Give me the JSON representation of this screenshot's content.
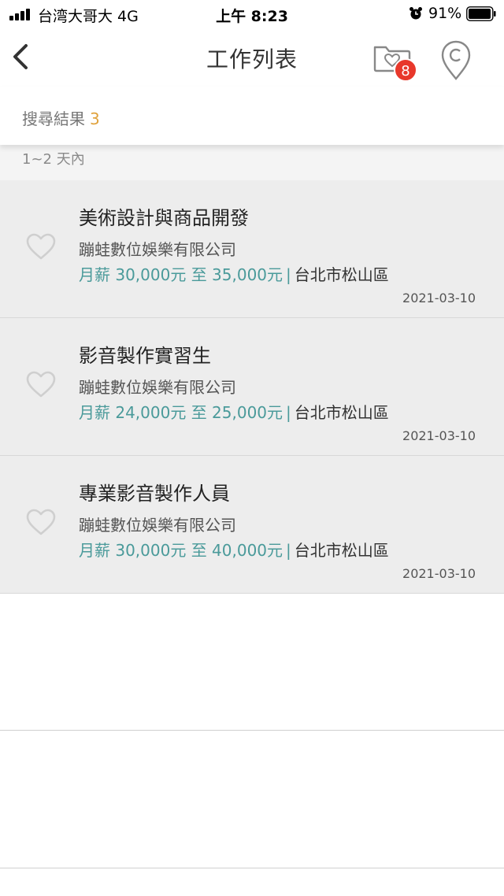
{
  "status_bar": {
    "carrier": "台湾大哥大  4G",
    "time": "上午 8:23",
    "battery": "91%"
  },
  "header": {
    "title": "工作列表",
    "saved_badge": "8"
  },
  "search": {
    "label": "搜尋結果",
    "count": "3"
  },
  "section": {
    "label": "1~2 天內"
  },
  "jobs": [
    {
      "title": "美術設計與商品開發",
      "company": "蹦蛙數位娛樂有限公司",
      "salary": "月薪 30,000元 至 35,000元",
      "separator": "|",
      "location": "台北市松山區",
      "date": "2021-03-10"
    },
    {
      "title": "影音製作實習生",
      "company": "蹦蛙數位娛樂有限公司",
      "salary": "月薪 24,000元 至 25,000元",
      "separator": "|",
      "location": "台北市松山區",
      "date": "2021-03-10"
    },
    {
      "title": "專業影音製作人員",
      "company": "蹦蛙數位娛樂有限公司",
      "salary": "月薪 30,000元 至 40,000元",
      "separator": "|",
      "location": "台北市松山區",
      "date": "2021-03-10"
    }
  ],
  "colors": {
    "accent_count": "#e0a23c",
    "salary": "#4a9a9a",
    "badge": "#e8382b",
    "card_bg": "#ededed"
  },
  "icons": [
    "back-icon",
    "favorites-folder-icon",
    "map-pin-icon",
    "heart-icon"
  ]
}
